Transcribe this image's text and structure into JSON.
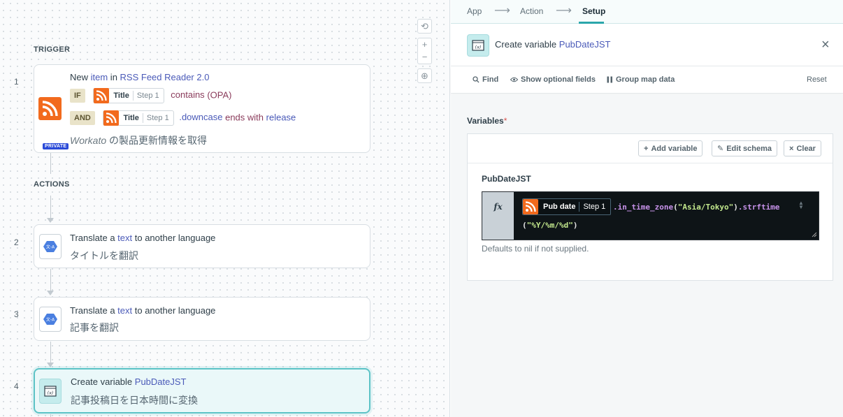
{
  "canvas": {
    "trigger_label": "TRIGGER",
    "actions_label": "ACTIONS",
    "zoom_controls": {
      "reset": "⟲",
      "zoom_in": "+",
      "zoom_out": "−",
      "fit": "⊕"
    },
    "steps": [
      {
        "number": "1",
        "title_prefix": "New ",
        "title_kw": "item",
        "title_mid": " in ",
        "title_app": "RSS Feed Reader 2.0",
        "condition_if": {
          "badge": "IF",
          "pill_name": "Title",
          "pill_step": "Step 1",
          "operator": "contains",
          "value": "(OPA)"
        },
        "condition_and": {
          "badge": "AND",
          "pill_name": "Title",
          "pill_step": "Step 1",
          "method": ".downcase",
          "operator": " ends with ",
          "value": "release"
        },
        "description_italic": "Workato",
        "description_rest": " の製品更新情報を取得",
        "private_badge": "PRIVATE"
      },
      {
        "number": "2",
        "title_prefix": "Translate a ",
        "title_kw": "text",
        "title_suffix": " to another language",
        "subtitle": "タイトルを翻訳"
      },
      {
        "number": "3",
        "title_prefix": "Translate a ",
        "title_kw": "text",
        "title_suffix": " to another language",
        "subtitle": "記事を翻訳"
      },
      {
        "number": "4",
        "title_prefix": "Create variable ",
        "title_kw": "PubDateJST",
        "subtitle": "記事投稿日を日本時間に変換"
      }
    ]
  },
  "panel": {
    "breadcrumbs": [
      "App",
      "Action",
      "Setup"
    ],
    "header_prefix": "Create variable ",
    "header_name": "PubDateJST",
    "close_icon": "×",
    "toolbar": {
      "find": "Find",
      "show_optional": "Show optional fields",
      "group_map": "Group map data",
      "reset": "Reset"
    },
    "variables_label": "Variables",
    "required_mark": "*",
    "buttons": {
      "add": "Add variable",
      "edit": "Edit schema",
      "clear": "Clear"
    },
    "field_label": "PubDateJST",
    "formula": {
      "fx": "fx",
      "pill_name": "Pub date",
      "pill_step": "Step 1",
      "m1": ".in_time_zone",
      "p1": "(",
      "s1": "\"Asia/Tokyo\"",
      "p2": ")",
      "m2": ".strftime",
      "p3": "(",
      "s2": "\"%Y/%m/%d\"",
      "p4": ")"
    },
    "hint": "Defaults to nil if not supplied."
  },
  "colors": {
    "accent": "#2ba6ab",
    "rss": "#f26a1d",
    "keyword": "#4a5ab8",
    "operator": "#8a3b5b"
  }
}
